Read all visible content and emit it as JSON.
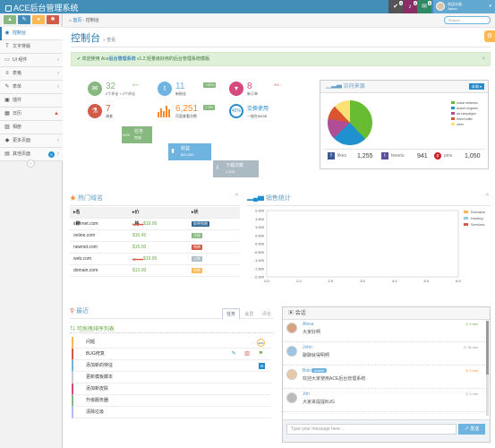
{
  "navbar": {
    "brand": "ACE后台管理系统",
    "tasks_count": "4",
    "notif_count": "8",
    "mail_count": "5",
    "welcome": "欢迎光临,",
    "username": "Jason"
  },
  "sidebar": {
    "items": [
      {
        "label": "控制台",
        "icon": "dashboard-icon"
      },
      {
        "label": "文字排版",
        "icon": "text-icon"
      },
      {
        "label": "UI 组件",
        "icon": "desktop-icon"
      },
      {
        "label": "表格",
        "icon": "list-icon"
      },
      {
        "label": "表单",
        "icon": "edit-icon"
      },
      {
        "label": "插件",
        "icon": "tag-icon"
      },
      {
        "label": "日历",
        "icon": "calendar-icon"
      },
      {
        "label": "相册",
        "icon": "picture-icon"
      },
      {
        "label": "更多页面",
        "icon": "tags-icon"
      },
      {
        "label": "其他页面",
        "icon": "file-icon"
      }
    ],
    "shortcut_colors": [
      "#87b87f",
      "#438eb9",
      "#ffb752",
      "#d15b47"
    ]
  },
  "breadcrumb": {
    "home": "首页",
    "current": "控制台"
  },
  "search": {
    "placeholder": "Search ..."
  },
  "page": {
    "title": "控制台",
    "subtitle": "查看"
  },
  "alert": {
    "prefix": "欢迎使用 Ace",
    "brand": "后台管理系统",
    "version": "v1.2",
    "suffix": ",轻量级好用的后台管理系统模版."
  },
  "stats": [
    {
      "value": "32",
      "label": "2个评论 + 2个评论",
      "pct": "8%",
      "color": "#87b87f",
      "icon": "comment-icon"
    },
    {
      "value": "11",
      "label": "新粉丝",
      "pct": "+32%",
      "color": "#6fb3e0",
      "icon": "twitter-icon"
    },
    {
      "value": "8",
      "label": "新订单",
      "pct": "4%",
      "color": "#d6487e",
      "icon": "cart-icon"
    },
    {
      "value": "7",
      "label": "调查",
      "color": "#d15b47",
      "icon": "flask-icon"
    },
    {
      "value": "6,251",
      "label": "页面查看次数",
      "pct": "7.2%",
      "color": "#ff892a",
      "icon": "bar-icon"
    },
    {
      "value": "42%",
      "label": "交换使用",
      "sub": "一般在58GB",
      "color": "#2a8bcb",
      "icon": "ring-icon"
    }
  ],
  "miniboxes": [
    {
      "a": "任务",
      "b": "完成",
      "color": "#87b87f",
      "icon": "61%"
    },
    {
      "a": "收益",
      "b": "$32,000",
      "color": "#6fb3e0",
      "icon": "chart-icon"
    },
    {
      "a": "下载次数",
      "b": "1,205",
      "color": "#abbac3",
      "icon": "download-icon"
    }
  ],
  "traffic": {
    "title": "访问来源",
    "button": "本周",
    "legend": [
      "social networks",
      "search engines",
      "ad campaigns",
      "direct traffic",
      "other"
    ],
    "colors": [
      "#68bc31",
      "#2091cf",
      "#af4e96",
      "#da5430",
      "#fee074"
    ],
    "shares": [
      38.7,
      24.5,
      8.2,
      18.6,
      10
    ],
    "social": [
      {
        "name": "likes",
        "count": "1,255",
        "color": "#3b5998",
        "icon": "facebook-icon"
      },
      {
        "name": "tweets",
        "count": "941",
        "color": "#5d4d9a",
        "icon": "twitter-icon"
      },
      {
        "name": "pins",
        "count": "1,050",
        "color": "#cb2027",
        "icon": "pinterest-icon"
      }
    ]
  },
  "domains": {
    "title": "热门域名",
    "headers": [
      "名称",
      "价格",
      "状态"
    ],
    "rows": [
      {
        "name": "internet.com",
        "old": "$29.99",
        "price": "$19.99",
        "status": "即将到期",
        "color": "#2a6496"
      },
      {
        "name": "online.com",
        "old": "",
        "price": "$16.45",
        "status": "注册",
        "color": "#87b87f"
      },
      {
        "name": "newnet.com",
        "old": "",
        "price": "$15.00",
        "status": "待审",
        "color": "#d15b47"
      },
      {
        "name": "web.com",
        "old": "$24.99",
        "price": "$19.95",
        "status": "过期",
        "color": "#abbac3"
      },
      {
        "name": "domain.com",
        "old": "",
        "price": "$12.00",
        "status": "待售",
        "color": "#ffb752"
      }
    ]
  },
  "sales": {
    "title": "销售统计",
    "chart_data": {
      "type": "line",
      "yticks": [
        "2.000",
        "1.500",
        "1.000",
        "0.500",
        "0.000",
        "-0.500",
        "-1.000",
        "-1.500",
        "-2.000"
      ],
      "xticks": [
        "0.0",
        "1.0",
        "2.0",
        "3.0",
        "4.0",
        "5.0",
        "6.0"
      ],
      "ylim": [
        -2,
        2
      ],
      "xlim": [
        0,
        6
      ],
      "legend": [
        "Domains",
        "Hosting",
        "Services"
      ],
      "colors": [
        "#ffb752",
        "#93cae5",
        "#d15b47"
      ]
    }
  },
  "recent": {
    "title": "最近",
    "tabs": [
      "任务",
      "会员",
      "评论"
    ],
    "list_title": "可拖拽排序列表",
    "tasks": [
      {
        "label": "问题",
        "color": "#ffb752"
      },
      {
        "label": "BUG修复",
        "color": "#d15b47"
      },
      {
        "label": "添加新的特征",
        "color": "#6fb3e0"
      },
      {
        "label": "更新模板脚本",
        "color": "#ccc"
      },
      {
        "label": "添加新皮肤",
        "color": "#d6487e"
      },
      {
        "label": "升级服务器",
        "color": "#87b87f"
      },
      {
        "label": "清除垃圾",
        "color": "#b6b6ff"
      }
    ],
    "progress": "42%"
  },
  "chat": {
    "title": "会话",
    "messages": [
      {
        "name": "Alexa",
        "text": "大家好啊",
        "time": "4 sec",
        "avcolor": "#d6a37d"
      },
      {
        "name": "John",
        "text": "聊聊就得明啊",
        "time": "38 sec",
        "avcolor": "#9ec3e0"
      },
      {
        "name": "Bob",
        "badge": "admin",
        "text": "欢迎大家使用ACE后台管理系统.",
        "time": "2 min",
        "avcolor": "#e8c9a8"
      },
      {
        "name": "Jim",
        "text": "大家来提提BUG",
        "time": "3 min",
        "avcolor": "#bbbbbb"
      }
    ],
    "placeholder": "Type your message here ...",
    "send": "发送"
  }
}
